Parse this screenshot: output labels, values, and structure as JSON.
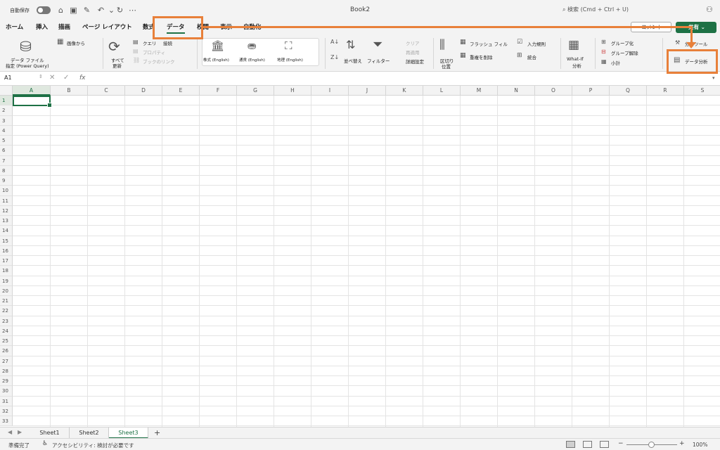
{
  "titlebar": {
    "autosave_label": "自動保存",
    "title": "Book2",
    "search_placeholder": "検索 (Cmd + Ctrl + U)"
  },
  "tabs": [
    {
      "label": "ホーム"
    },
    {
      "label": "挿入"
    },
    {
      "label": "描画"
    },
    {
      "label": "ページ レイアウト"
    },
    {
      "label": "数式"
    },
    {
      "label": "データ",
      "active": true
    },
    {
      "label": "校閲"
    },
    {
      "label": "表示"
    },
    {
      "label": "自動化"
    }
  ],
  "actions": {
    "comment_label": "コメント",
    "share_label": "共有"
  },
  "ribbon": {
    "get_data_label": "データ ファイル",
    "get_data_sub": "指定 (Power Query)",
    "from_image": "画像から",
    "refresh_all_1": "すべて",
    "refresh_all_2": "更新",
    "queries": "クエリ",
    "connections": "接続",
    "properties": "プロパティ",
    "workbook_links": "ブックのリンク",
    "stocks": "株式 (English)",
    "currencies": "通貨 (English)",
    "geography": "地理 (English)",
    "sort": "並べ替え",
    "filter": "フィルター",
    "clear": "クリア",
    "reapply": "再適用",
    "advanced": "詳細設定",
    "text_to_columns_1": "区切り",
    "text_to_columns_2": "位置",
    "flash_fill": "フラッシュ フィル",
    "remove_duplicates": "重複を削除",
    "data_validation": "入力規則",
    "consolidate": "統合",
    "what_if_1": "What-If",
    "what_if_2": "分析",
    "group": "グループ化",
    "ungroup": "グループ解除",
    "subtotal": "小計",
    "analysis_tools": "分析ツール",
    "data_analysis": "データ分析"
  },
  "formula_bar": {
    "name_box": "A1",
    "fx": "fx"
  },
  "columns": [
    "A",
    "B",
    "C",
    "D",
    "E",
    "F",
    "G",
    "H",
    "I",
    "J",
    "K",
    "L",
    "M",
    "N",
    "O",
    "P",
    "Q",
    "R",
    "S"
  ],
  "rows": [
    "1",
    "2",
    "3",
    "4",
    "5",
    "6",
    "7",
    "8",
    "9",
    "10",
    "11",
    "12",
    "13",
    "14",
    "15",
    "16",
    "17",
    "18",
    "19",
    "20",
    "21",
    "22",
    "23",
    "24",
    "25",
    "26",
    "27",
    "28",
    "29",
    "30",
    "31",
    "32",
    "33"
  ],
  "sheets": [
    {
      "label": "Sheet1"
    },
    {
      "label": "Sheet2"
    },
    {
      "label": "Sheet3",
      "active": true
    }
  ],
  "status": {
    "ready": "準備完了",
    "accessibility": "アクセシビリティ: 検討が必要です",
    "zoom": "100%",
    "zoom_minus": "−",
    "zoom_plus": "+"
  },
  "colors": {
    "accent": "#1e7145",
    "highlight": "#e8803a"
  }
}
